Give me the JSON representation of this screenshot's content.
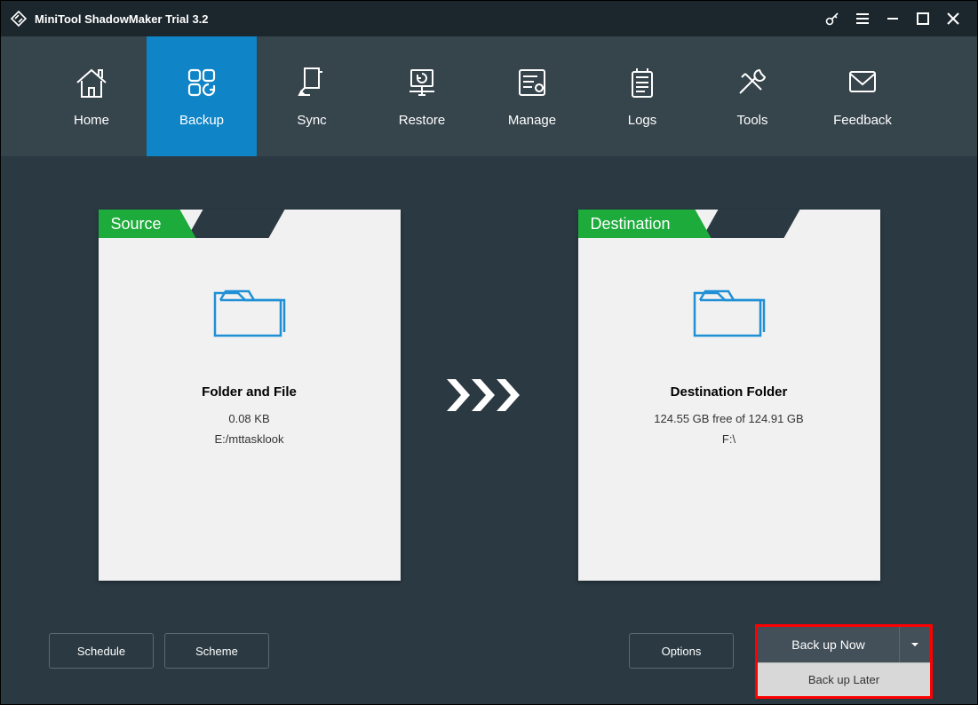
{
  "title": "MiniTool ShadowMaker Trial 3.2",
  "nav": [
    {
      "label": "Home"
    },
    {
      "label": "Backup"
    },
    {
      "label": "Sync"
    },
    {
      "label": "Restore"
    },
    {
      "label": "Manage"
    },
    {
      "label": "Logs"
    },
    {
      "label": "Tools"
    },
    {
      "label": "Feedback"
    }
  ],
  "source": {
    "tab": "Source",
    "title": "Folder and File",
    "line1": "0.08 KB",
    "line2": "E:/mttasklook"
  },
  "destination": {
    "tab": "Destination",
    "title": "Destination Folder",
    "line1": "124.55 GB free of 124.91 GB",
    "line2": "F:\\"
  },
  "buttons": {
    "schedule": "Schedule",
    "scheme": "Scheme",
    "options": "Options",
    "backup_now": "Back up Now",
    "backup_later": "Back up Later"
  }
}
